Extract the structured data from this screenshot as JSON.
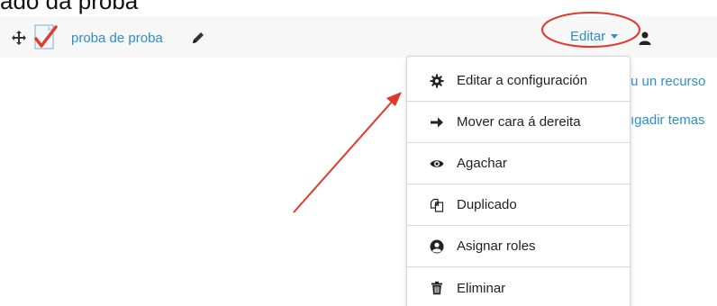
{
  "page_heading": "ado da proba",
  "activity": {
    "name": "proba de proba",
    "move_icon": "move-icon",
    "type_icon": "quiz-check-icon",
    "edit_title_icon": "pencil-icon"
  },
  "edit_menu": {
    "toggle_label": "Editar",
    "items": [
      {
        "label": "Editar a configuración",
        "icon": "gear-icon"
      },
      {
        "label": "Mover cara á dereita",
        "icon": "arrow-right-icon"
      },
      {
        "label": "Agachar",
        "icon": "eye-icon"
      },
      {
        "label": "Duplicado",
        "icon": "copy-icon"
      },
      {
        "label": "Asignar roles",
        "icon": "user-circle-icon"
      },
      {
        "label": "Eliminar",
        "icon": "trash-icon"
      }
    ]
  },
  "behind_links": [
    "u un recurso",
    "ıgadir temas"
  ],
  "colors": {
    "link": "#2c8ecb",
    "annotation": "#e0392b",
    "row_background": "#f7f7f7"
  }
}
